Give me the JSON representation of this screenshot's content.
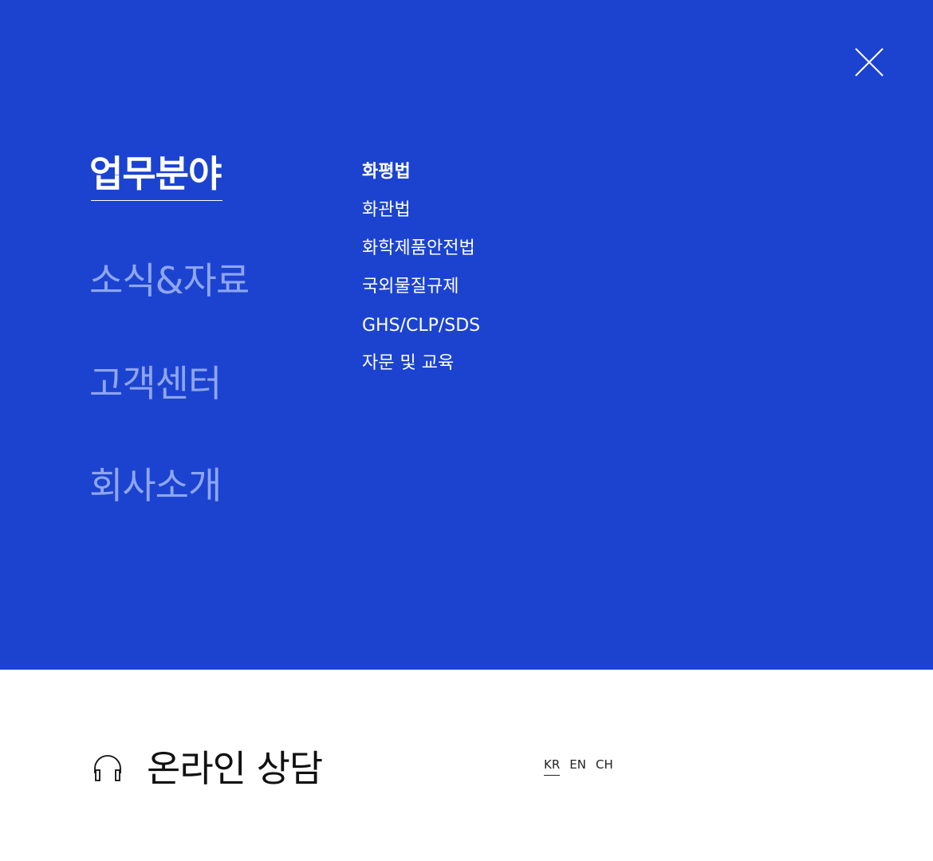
{
  "colors": {
    "panel_background": "#1c43d0",
    "active_text": "#ffffff",
    "inactive_text": "#8ea6ef",
    "footer_background": "#ffffff",
    "footer_text": "#111111"
  },
  "close": {
    "icon": "close-icon"
  },
  "main_menu": {
    "items": [
      {
        "label": "업무분야",
        "active": true
      },
      {
        "label": "소식&자료",
        "active": false
      },
      {
        "label": "고객센터",
        "active": false
      },
      {
        "label": "회사소개",
        "active": false
      }
    ]
  },
  "sub_menu": {
    "items": [
      {
        "label": "화평법",
        "active": true
      },
      {
        "label": "화관법",
        "active": false
      },
      {
        "label": "화학제품안전법",
        "active": false
      },
      {
        "label": "국외물질규제",
        "active": false
      },
      {
        "label": "GHS/CLP/SDS",
        "active": false
      },
      {
        "label": "자문 및 교육",
        "active": false
      }
    ]
  },
  "footer": {
    "consult": {
      "icon": "headphone-icon",
      "label": "온라인 상담"
    },
    "languages": [
      {
        "label": "KR",
        "active": true
      },
      {
        "label": "EN",
        "active": false
      },
      {
        "label": "CH",
        "active": false
      }
    ]
  }
}
